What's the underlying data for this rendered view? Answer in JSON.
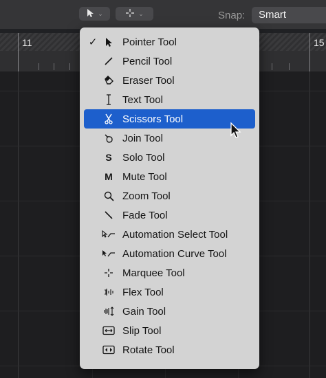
{
  "toolbar": {
    "left_tool_icon": "pointer-icon",
    "right_tool_icon": "marquee-crosshair-icon",
    "snap_label": "Snap:",
    "snap_value": "Smart"
  },
  "ruler": {
    "bar_left": "11",
    "bar_right": "15"
  },
  "menu": {
    "items": [
      {
        "label": "Pointer Tool",
        "icon": "pointer-icon",
        "checked": true
      },
      {
        "label": "Pencil Tool",
        "icon": "pencil-icon"
      },
      {
        "label": "Eraser Tool",
        "icon": "eraser-icon"
      },
      {
        "label": "Text Tool",
        "icon": "text-cursor-icon"
      },
      {
        "label": "Scissors Tool",
        "icon": "scissors-icon",
        "highlighted": true
      },
      {
        "label": "Join Tool",
        "icon": "join-icon"
      },
      {
        "label": "Solo Tool",
        "icon": "solo-icon",
        "glyph": "S"
      },
      {
        "label": "Mute Tool",
        "icon": "mute-icon",
        "glyph": "M"
      },
      {
        "label": "Zoom Tool",
        "icon": "zoom-icon"
      },
      {
        "label": "Fade Tool",
        "icon": "fade-icon"
      },
      {
        "label": "Automation Select Tool",
        "icon": "automation-select-icon"
      },
      {
        "label": "Automation Curve Tool",
        "icon": "automation-curve-icon"
      },
      {
        "label": "Marquee Tool",
        "icon": "marquee-icon"
      },
      {
        "label": "Flex Tool",
        "icon": "flex-icon"
      },
      {
        "label": "Gain Tool",
        "icon": "gain-icon"
      },
      {
        "label": "Slip Tool",
        "icon": "slip-icon"
      },
      {
        "label": "Rotate Tool",
        "icon": "rotate-icon"
      }
    ],
    "checkmark": "✓"
  },
  "colors": {
    "menu_bg": "#d3d3d3",
    "highlight": "#1d5fcc",
    "toolbar_bg": "#353537",
    "canvas_bg": "#1e1e20"
  }
}
